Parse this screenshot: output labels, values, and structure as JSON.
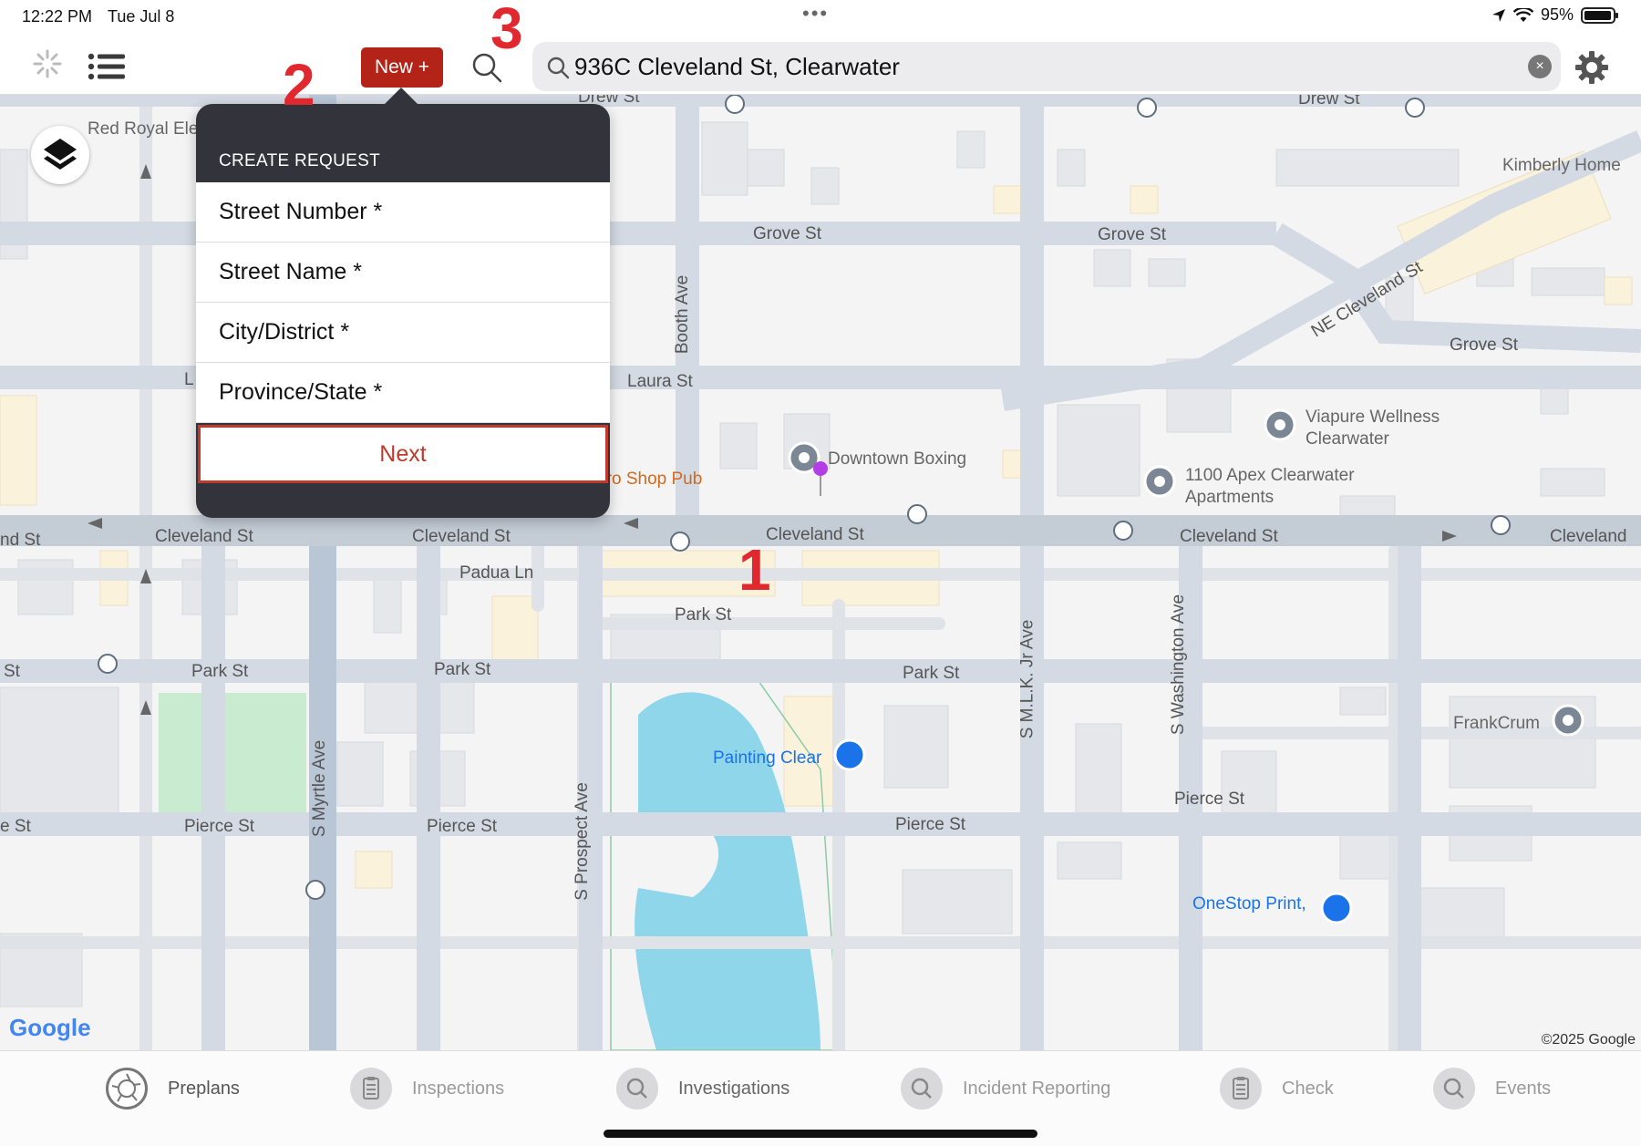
{
  "status_bar": {
    "time": "12:22 PM",
    "date": "Tue Jul 8",
    "dots": "•••",
    "battery": "95%"
  },
  "toolbar": {
    "new_button": "New +",
    "search_value": "936C Cleveland St, Clearwater",
    "clear_label": "×"
  },
  "popover": {
    "title": "CREATE REQUEST",
    "fields": [
      "Street Number *",
      "Street Name *",
      "City/District *",
      "Province/State *"
    ],
    "next_label": "Next"
  },
  "annotations": [
    "1",
    "2",
    "3"
  ],
  "map": {
    "streets": {
      "drew_st_a": "Drew St",
      "drew_st_b": "Drew St",
      "grove_st_a": "Grove St",
      "grove_st_b": "Grove St",
      "grove_st_c": "Grove St",
      "ne_cleveland": "NE Cleveland St",
      "laura_st": "Laura St",
      "laura_st_left": "L",
      "booth_ave": "Booth Ave",
      "cleveland_edge": "nd St",
      "cleveland_a": "Cleveland St",
      "cleveland_b": "Cleveland St",
      "cleveland_c": "Cleveland St",
      "cleveland_d": "Cleveland St",
      "cleveland_right": "Cleveland",
      "padua_ln": "Padua Ln",
      "park_st_edge": "St",
      "park_st_a": "Park St",
      "park_st_b": "Park St",
      "park_st_c": "Park St",
      "park_st_d": "Park St",
      "pierce_edge": "e St",
      "pierce_a": "Pierce St",
      "pierce_b": "Pierce St",
      "pierce_c": "Pierce St",
      "pierce_d": "Pierce St",
      "myrtle_ave": "S Myrtle Ave",
      "prospect_ave": "S Prospect Ave",
      "mlk_ave": "S M.L.K. Jr Ave",
      "washington_ave": "S Washington Ave"
    },
    "pois": {
      "red_royal": "Red Royal Ele",
      "kimberly": "Kimberly Home",
      "viapure_1": "Viapure Wellness",
      "viapure_2": "Clearwater",
      "apex_1": "1100 Apex Clearwater",
      "apex_2": "Apartments",
      "downtown_boxing": "Downtown Boxing",
      "pro_shop_pub": "Pro Shop Pub",
      "painting_clear": "Painting Clear",
      "frankcrum": "FrankCrum",
      "onestop": "OneStop Print,"
    },
    "google": "Google",
    "copyright": "©2025 Google",
    "colors": {
      "road": "#d3dae3",
      "major_road": "#c4ccd6",
      "water": "#8fd6ea",
      "park": "#c9ecd0",
      "building": "#e9eaed",
      "poi_orange": "#e07a1f",
      "poi_blue": "#1a73e8"
    }
  },
  "tabs": [
    {
      "label": "Preplans",
      "icon": "aperture-icon"
    },
    {
      "label": "Inspections",
      "icon": "clipboard-icon"
    },
    {
      "label": "Investigations",
      "icon": "magnifier-icon"
    },
    {
      "label": "Incident Reporting",
      "icon": "magnifier-icon"
    },
    {
      "label": "Check",
      "icon": "clipboard-icon"
    },
    {
      "label": "Events",
      "icon": "magnifier-icon"
    }
  ]
}
